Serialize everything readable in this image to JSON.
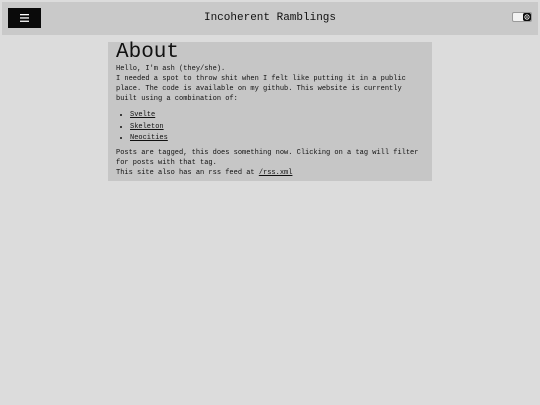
{
  "header": {
    "title": "Incoherent Ramblings",
    "menu_icon": "hamburger-icon",
    "theme_toggle_icon": "gear-icon"
  },
  "about": {
    "heading": "About",
    "greeting": "Hello, I'm ash (they/she).",
    "intro": "I needed a spot to throw shit when I felt like putting it in a public place. The code is available on my github. This website is currently built using a combination of:",
    "tools": [
      "Svelte",
      "Skeleton",
      "Neocities"
    ],
    "tags_text": "Posts are tagged, this does something now. Clicking on a tag will filter for posts with that tag.",
    "rss_prefix": "This site also has an rss feed at ",
    "rss_link": "/rss.xml"
  },
  "colors": {
    "page_bg": "#dcdcdc",
    "header_bg": "#c9c9c9",
    "content_bg": "#c6c6c6",
    "accent": "#0a0a0a"
  }
}
